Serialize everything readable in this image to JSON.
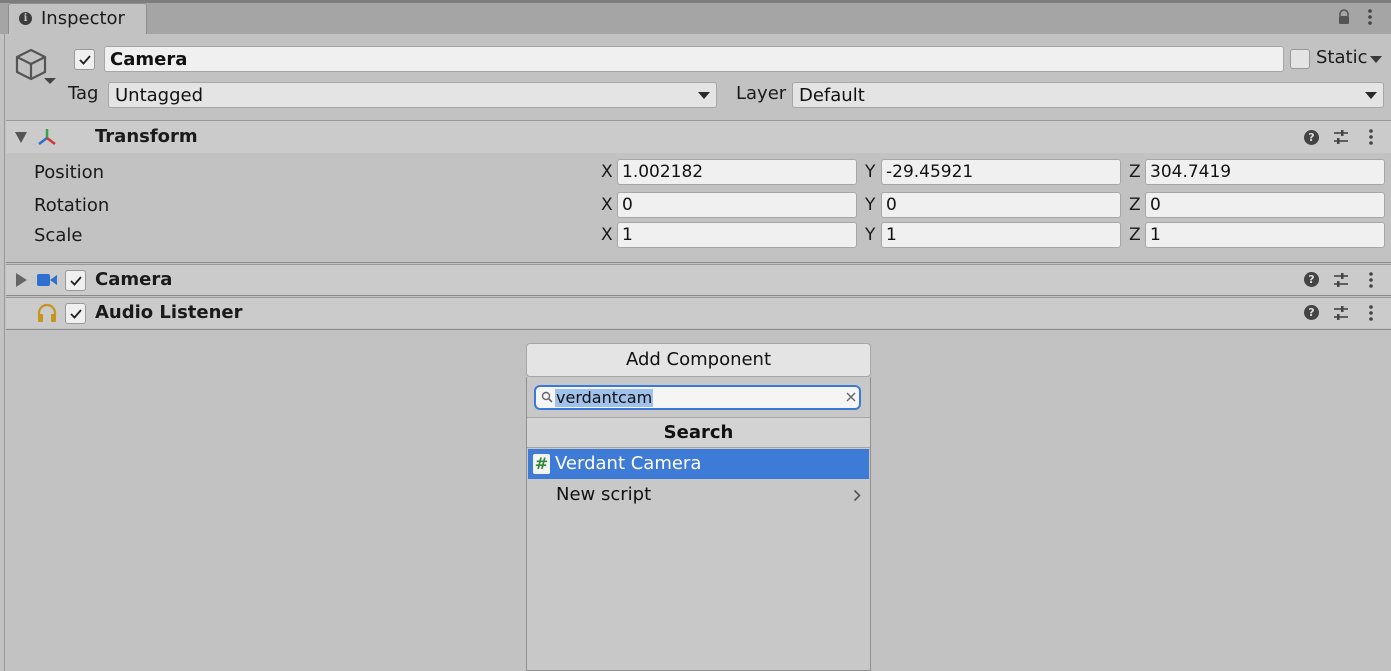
{
  "tab": {
    "label": "Inspector"
  },
  "object": {
    "name": "Camera",
    "static_label": "Static"
  },
  "tag": {
    "label": "Tag",
    "value": "Untagged"
  },
  "layer": {
    "label": "Layer",
    "value": "Default"
  },
  "transform": {
    "title": "Transform",
    "rows": [
      {
        "label": "Position",
        "x": "1.002182",
        "y": "-29.45921",
        "z": "304.7419"
      },
      {
        "label": "Rotation",
        "x": "0",
        "y": "0",
        "z": "0"
      },
      {
        "label": "Scale",
        "x": "1",
        "y": "1",
        "z": "1"
      }
    ],
    "axis_labels": {
      "x": "X",
      "y": "Y",
      "z": "Z"
    }
  },
  "components": [
    {
      "title": "Camera"
    },
    {
      "title": "Audio Listener"
    }
  ],
  "add_component": {
    "button_label": "Add Component",
    "search_value": "verdantcam",
    "section_title": "Search",
    "items": [
      {
        "label": "Verdant Camera",
        "icon": "script-icon"
      },
      {
        "label": "New script"
      }
    ]
  },
  "colors": {
    "selection": "#3e7bd6",
    "background": "#c2c2c2"
  }
}
